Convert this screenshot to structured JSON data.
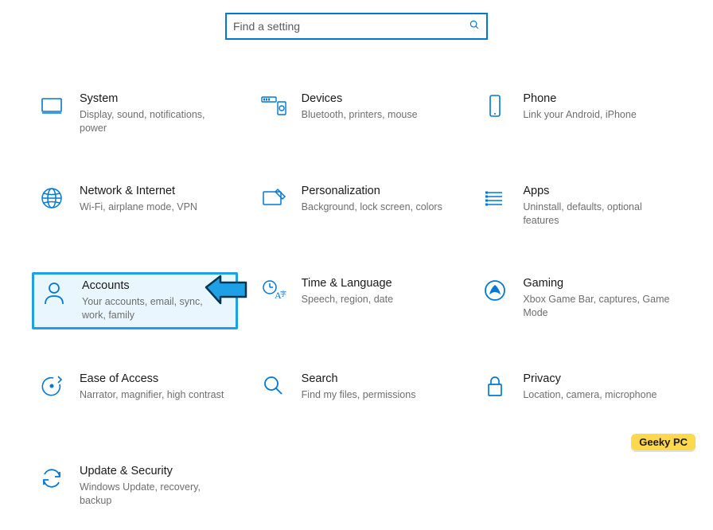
{
  "search": {
    "placeholder": "Find a setting"
  },
  "tiles": [
    {
      "id": "system",
      "title": "System",
      "desc": "Display, sound, notifications, power"
    },
    {
      "id": "devices",
      "title": "Devices",
      "desc": "Bluetooth, printers, mouse"
    },
    {
      "id": "phone",
      "title": "Phone",
      "desc": "Link your Android, iPhone"
    },
    {
      "id": "network",
      "title": "Network & Internet",
      "desc": "Wi-Fi, airplane mode, VPN"
    },
    {
      "id": "personalization",
      "title": "Personalization",
      "desc": "Background, lock screen, colors"
    },
    {
      "id": "apps",
      "title": "Apps",
      "desc": "Uninstall, defaults, optional features"
    },
    {
      "id": "accounts",
      "title": "Accounts",
      "desc": "Your accounts, email, sync, work, family",
      "highlighted": true
    },
    {
      "id": "time-language",
      "title": "Time & Language",
      "desc": "Speech, region, date"
    },
    {
      "id": "gaming",
      "title": "Gaming",
      "desc": "Xbox Game Bar, captures, Game Mode"
    },
    {
      "id": "ease-of-access",
      "title": "Ease of Access",
      "desc": "Narrator, magnifier, high contrast"
    },
    {
      "id": "search-tile",
      "title": "Search",
      "desc": "Find my files, permissions"
    },
    {
      "id": "privacy",
      "title": "Privacy",
      "desc": "Location, camera, microphone"
    },
    {
      "id": "update-security",
      "title": "Update & Security",
      "desc": "Windows Update, recovery, backup"
    }
  ],
  "watermark": "Geeky PC",
  "colors": {
    "accent": "#0078d7",
    "highlight": "#1ea0e6"
  }
}
